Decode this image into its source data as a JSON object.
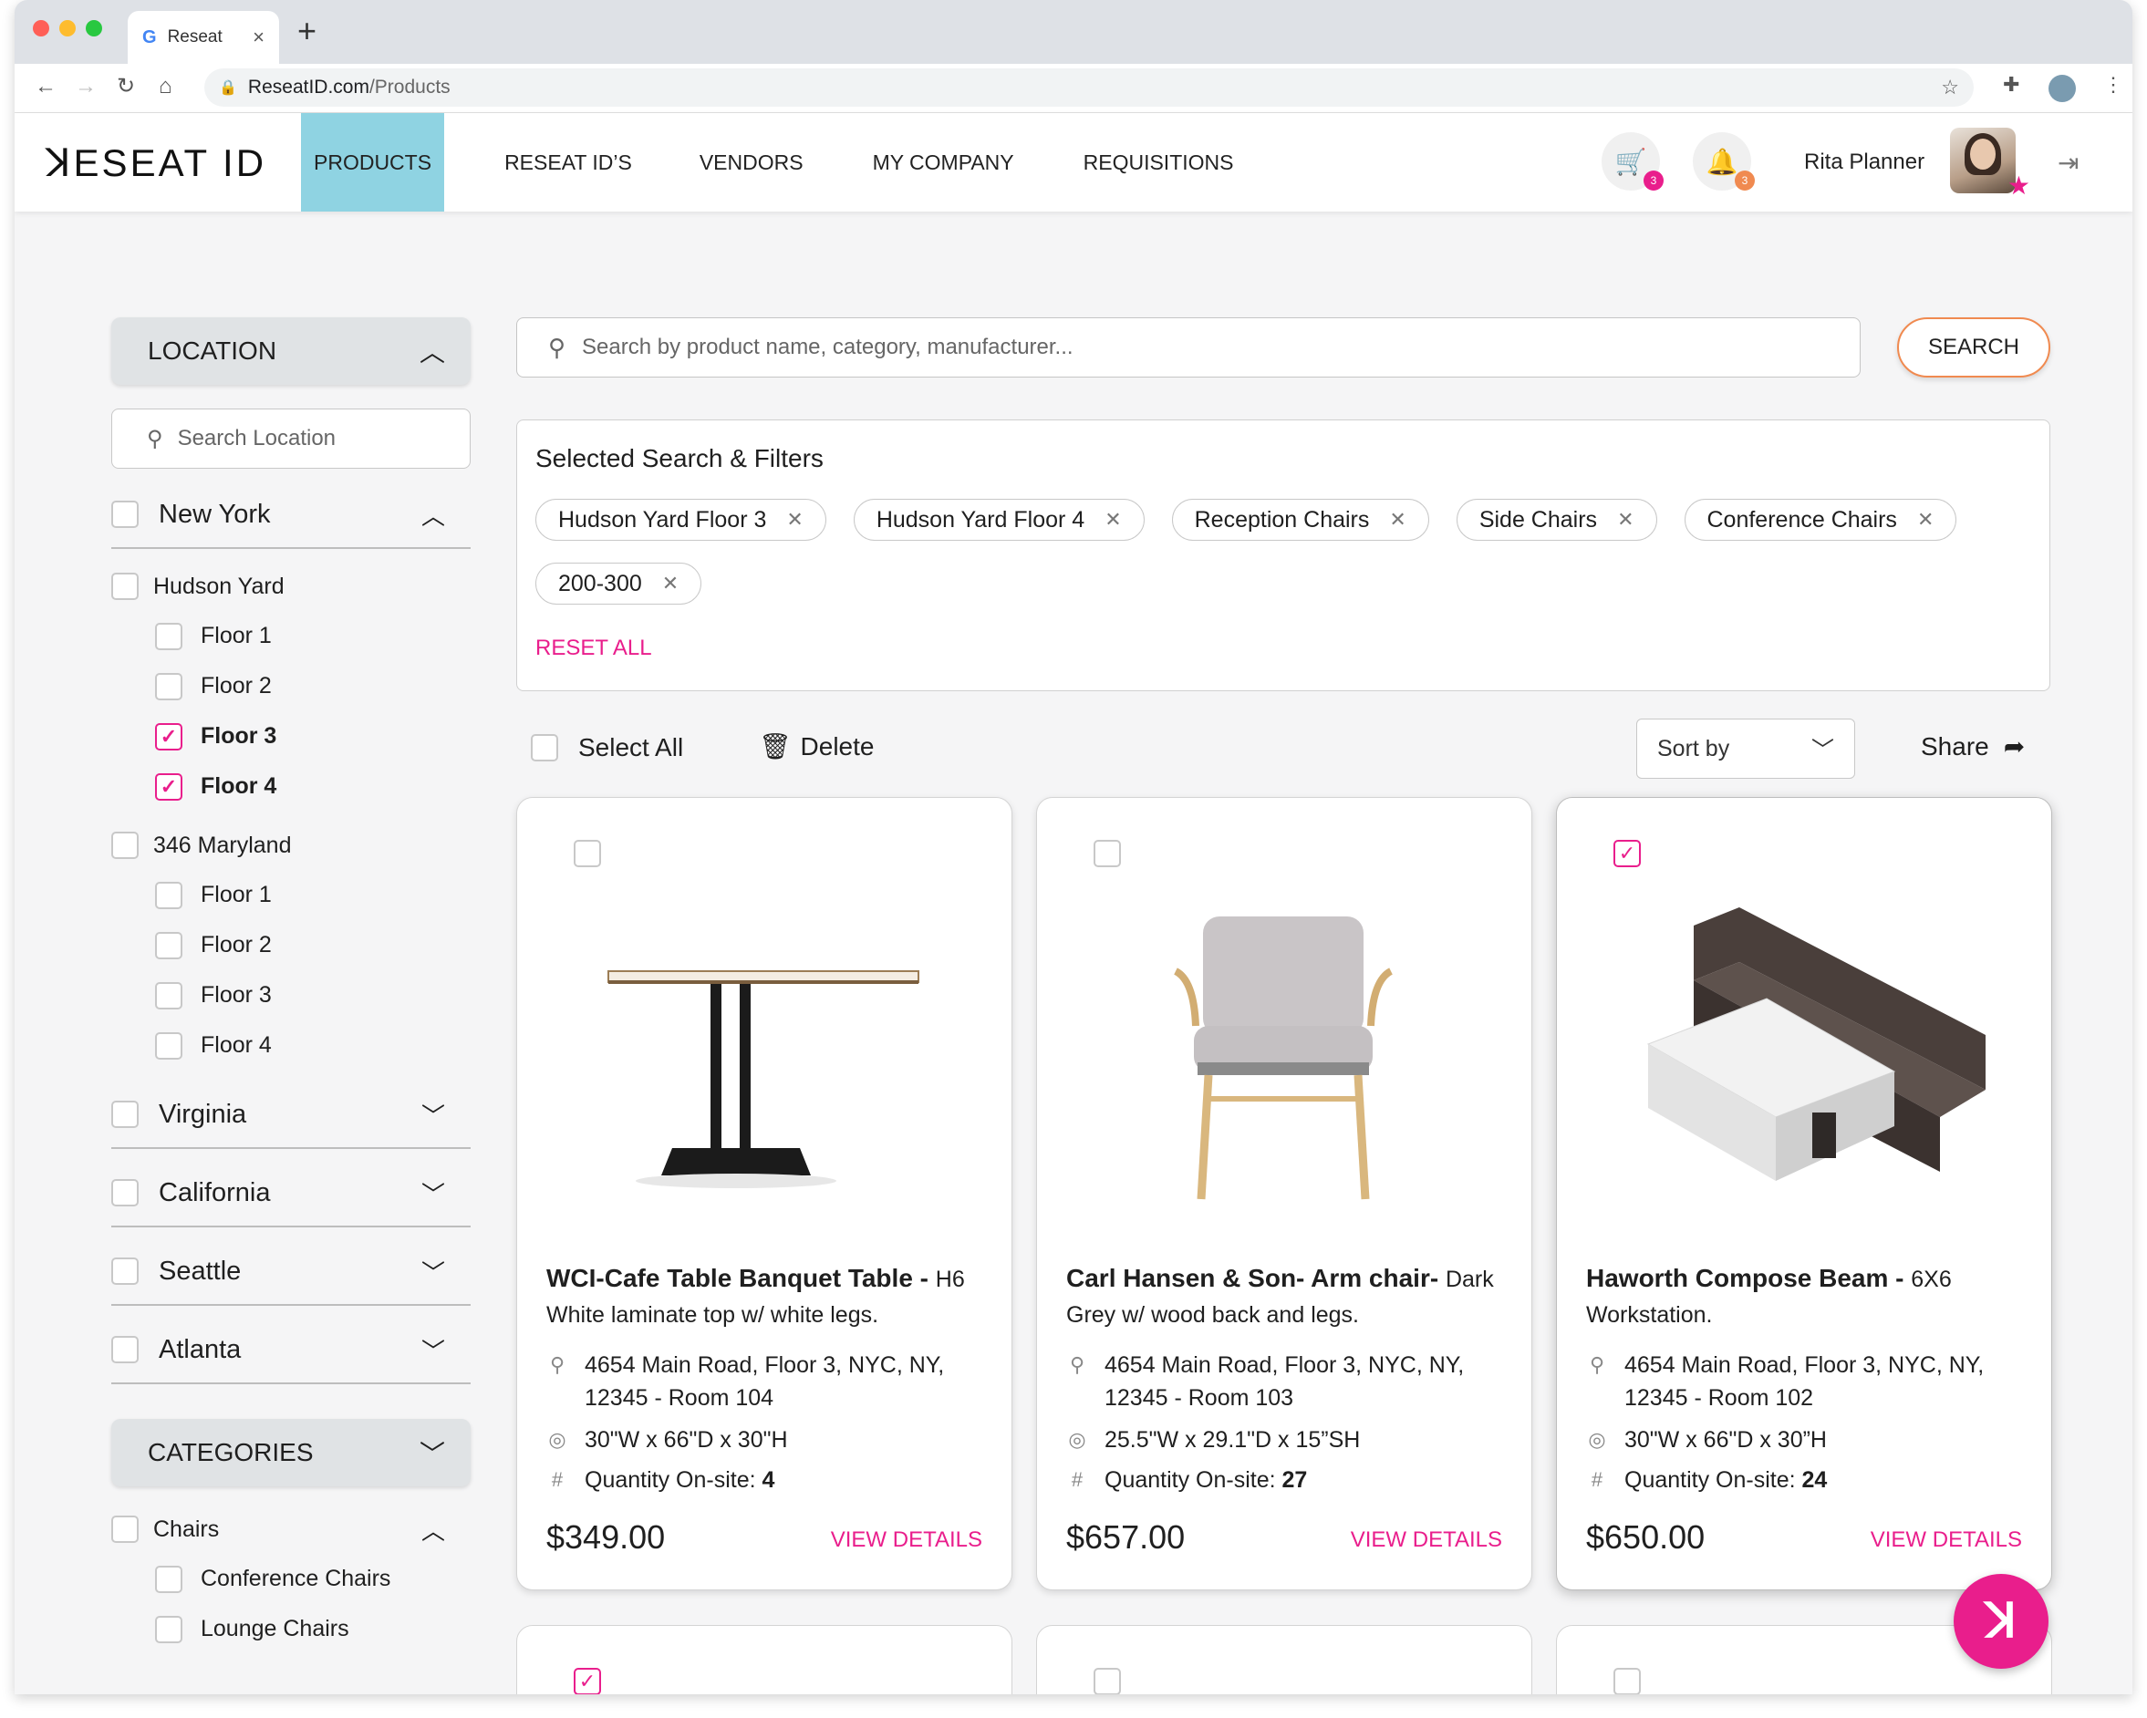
{
  "browser": {
    "tab_title": "Reseat",
    "url_host": "ReseatID.com",
    "url_path": "/Products"
  },
  "header": {
    "logo": "ꓘESEAT ID",
    "nav": [
      "PRODUCTS",
      "RESEAT ID’S",
      "VENDORS",
      "MY COMPANY",
      "REQUISITIONS"
    ],
    "active_nav": "PRODUCTS",
    "cart_badge": "3",
    "notif_badge": "3",
    "user_name": "Rita Planner"
  },
  "sidebar": {
    "location_title": "LOCATION",
    "search_placeholder": "Search Location",
    "states": {
      "new_york": "New York",
      "virginia": "Virginia",
      "california": "California",
      "seattle": "Seattle",
      "atlanta": "Atlanta"
    },
    "buildings": [
      {
        "name": "Hudson Yard",
        "floors": [
          "Floor 1",
          "Floor 2",
          "Floor 3",
          "Floor 4"
        ],
        "checked": [
          false,
          false,
          true,
          true
        ]
      },
      {
        "name": "346 Maryland",
        "floors": [
          "Floor 1",
          "Floor 2",
          "Floor 3",
          "Floor 4"
        ],
        "checked": [
          false,
          false,
          false,
          false
        ]
      }
    ],
    "categories_title": "CATEGORIES",
    "category": "Chairs",
    "subcategories": [
      "Conference Chairs",
      "Lounge Chairs"
    ]
  },
  "search": {
    "placeholder": "Search by product name, category, manufacturer...",
    "button": "SEARCH"
  },
  "filters": {
    "title": "Selected Search & Filters",
    "chips": [
      "Hudson Yard Floor 3",
      "Hudson Yard Floor 4",
      "Reception Chairs",
      "Side Chairs",
      "Conference Chairs",
      "200-300"
    ],
    "reset": "RESET ALL"
  },
  "toolbar": {
    "select_all": "Select All",
    "delete": "Delete",
    "sort": "Sort by",
    "share": "Share"
  },
  "products": [
    {
      "name": "WCI-Cafe Table Banquet Table -",
      "variant": "H6",
      "desc": "White laminate top w/ white legs.",
      "address": "4654 Main Road, Floor 3, NYC, NY, 12345 - Room  104",
      "dims": "30\"W x 66\"D x 30\"H",
      "qty_label": "Quantity On-site:",
      "qty": "4",
      "price": "$349.00",
      "cta": "VIEW DETAILS",
      "checked": false
    },
    {
      "name": "Carl Hansen & Son- Arm chair-",
      "variant": "Dark",
      "desc": "Grey w/ wood back and legs.",
      "address": "4654 Main Road, Floor 3, NYC, NY, 12345 - Room  103",
      "dims": "25.5\"W x 29.1\"D x 15”SH",
      "qty_label": "Quantity On-site:",
      "qty": "27",
      "price": "$657.00",
      "cta": "VIEW DETAILS",
      "checked": false
    },
    {
      "name": "Haworth Compose Beam -",
      "variant": "6X6",
      "desc": "Workstation.",
      "address": "4654 Main Road, Floor 3, NYC, NY, 12345 - Room  102",
      "dims": "30\"W x 66\"D x 30”H",
      "qty_label": "Quantity On-site:",
      "qty": "24",
      "price": "$650.00",
      "cta": "VIEW DETAILS",
      "checked": true
    }
  ],
  "colors": {
    "accent": "#e91e8c",
    "nav_active": "#8fd3e2",
    "search_border": "#f08a50"
  }
}
